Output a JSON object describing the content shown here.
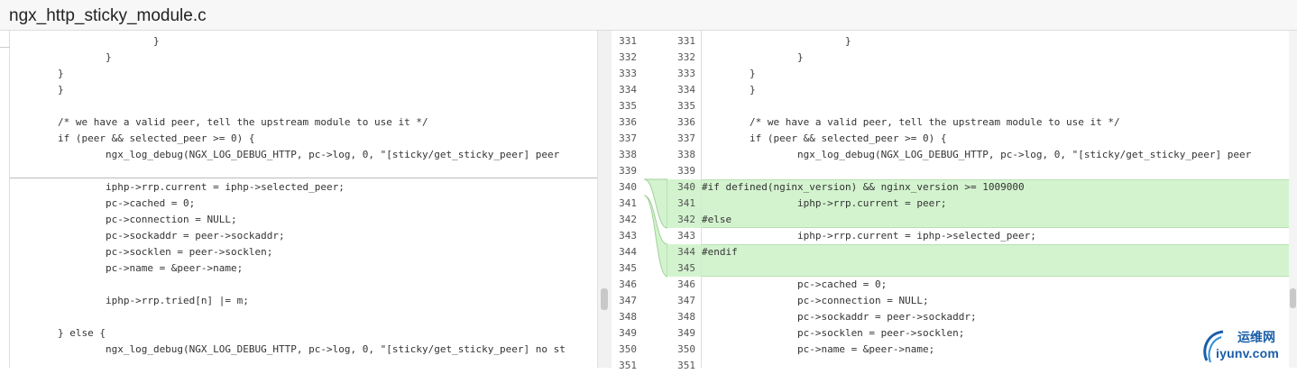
{
  "file": {
    "title": "ngx_http_sticky_module.c"
  },
  "colors": {
    "added_bg": "#d3f3cf",
    "connector_fill": "#d3f3cf",
    "connector_stroke": "#9fd196"
  },
  "left_pane": {
    "lines": [
      "                        }",
      "                }",
      "        }",
      "        }",
      "",
      "        /* we have a valid peer, tell the upstream module to use it */",
      "        if (peer && selected_peer >= 0) {",
      "                ngx_log_debug(NGX_LOG_DEBUG_HTTP, pc->log, 0, \"[sticky/get_sticky_peer] peer",
      "",
      "                iphp->rrp.current = iphp->selected_peer;",
      "                pc->cached = 0;",
      "                pc->connection = NULL;",
      "                pc->sockaddr = peer->sockaddr;",
      "                pc->socklen = peer->socklen;",
      "                pc->name = &peer->name;",
      "",
      "                iphp->rrp.tried[n] |= m;",
      "",
      "        } else {",
      "                ngx_log_debug(NGX_LOG_DEBUG_HTTP, pc->log, 0, \"[sticky/get_sticky_peer] no st",
      ""
    ]
  },
  "right_pane": {
    "old_numbers": [
      "331",
      "332",
      "333",
      "334",
      "335",
      "336",
      "337",
      "338",
      "339",
      "340",
      "341",
      "342",
      "343",
      "344",
      "345",
      "346",
      "347",
      "348",
      "349",
      "350",
      "351"
    ],
    "new_numbers": [
      "331",
      "332",
      "333",
      "334",
      "335",
      "336",
      "337",
      "338",
      "339",
      "340",
      "341",
      "342",
      "343",
      "344",
      "345",
      "346",
      "347",
      "348",
      "349",
      "350",
      "351"
    ],
    "lines": [
      "                        }",
      "                }",
      "        }",
      "        }",
      "",
      "        /* we have a valid peer, tell the upstream module to use it */",
      "        if (peer && selected_peer >= 0) {",
      "                ngx_log_debug(NGX_LOG_DEBUG_HTTP, pc->log, 0, \"[sticky/get_sticky_peer] peer",
      "",
      "#if defined(nginx_version) && nginx_version >= 1009000",
      "                iphp->rrp.current = peer;",
      "#else",
      "                iphp->rrp.current = iphp->selected_peer;",
      "#endif",
      "",
      "                pc->cached = 0;",
      "                pc->connection = NULL;",
      "                pc->sockaddr = peer->sockaddr;",
      "                pc->socklen = peer->socklen;",
      "                pc->name = &peer->name;",
      ""
    ]
  },
  "watermark": {
    "top_text": "运维网",
    "bottom_text": "iyunv.com"
  }
}
